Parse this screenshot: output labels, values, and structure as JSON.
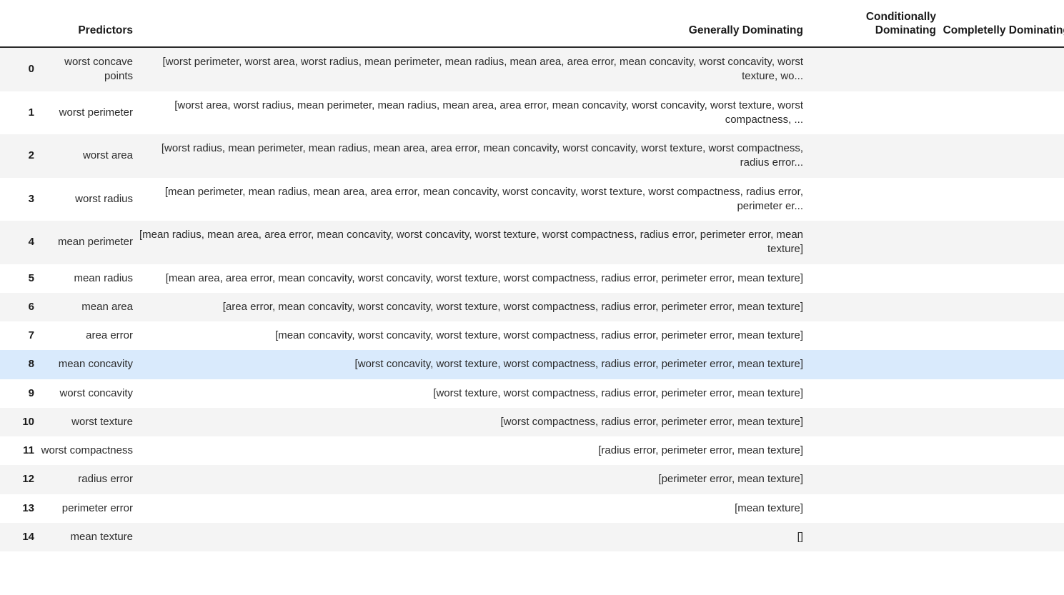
{
  "table": {
    "headers": {
      "index": "",
      "predictors": "Predictors",
      "generally_dominating": "Generally Dominating",
      "conditionally_dominating": "Conditionally Dominating",
      "completelly_dominating": "Completelly Dominating"
    },
    "highlighted_row_index": 8,
    "highlight_color": "#d9eafc",
    "stripe_color": "#f4f4f4",
    "rows": [
      {
        "index": "0",
        "predictor": "worst concave points",
        "generally_dominating": "[worst perimeter, worst area, worst radius, mean perimeter, mean radius, mean area, area error, mean concavity, worst concavity, worst texture, wo...",
        "conditionally_dominating": "",
        "completelly_dominating": ""
      },
      {
        "index": "1",
        "predictor": "worst perimeter",
        "generally_dominating": "[worst area, worst radius, mean perimeter, mean radius, mean area, area error, mean concavity, worst concavity, worst texture, worst compactness, ...",
        "conditionally_dominating": "",
        "completelly_dominating": ""
      },
      {
        "index": "2",
        "predictor": "worst area",
        "generally_dominating": "[worst radius, mean perimeter, mean radius, mean area, area error, mean concavity, worst concavity, worst texture, worst compactness, radius error...",
        "conditionally_dominating": "",
        "completelly_dominating": ""
      },
      {
        "index": "3",
        "predictor": "worst radius",
        "generally_dominating": "[mean perimeter, mean radius, mean area, area error, mean concavity, worst concavity, worst texture, worst compactness, radius error, perimeter er...",
        "conditionally_dominating": "",
        "completelly_dominating": ""
      },
      {
        "index": "4",
        "predictor": "mean perimeter",
        "generally_dominating": "[mean radius, mean area, area error, mean concavity, worst concavity, worst texture, worst compactness, radius error, perimeter error, mean texture]",
        "conditionally_dominating": "",
        "completelly_dominating": ""
      },
      {
        "index": "5",
        "predictor": "mean radius",
        "generally_dominating": "[mean area, area error, mean concavity, worst concavity, worst texture, worst compactness, radius error, perimeter error, mean texture]",
        "conditionally_dominating": "",
        "completelly_dominating": ""
      },
      {
        "index": "6",
        "predictor": "mean area",
        "generally_dominating": "[area error, mean concavity, worst concavity, worst texture, worst compactness, radius error, perimeter error, mean texture]",
        "conditionally_dominating": "",
        "completelly_dominating": ""
      },
      {
        "index": "7",
        "predictor": "area error",
        "generally_dominating": "[mean concavity, worst concavity, worst texture, worst compactness, radius error, perimeter error, mean texture]",
        "conditionally_dominating": "",
        "completelly_dominating": ""
      },
      {
        "index": "8",
        "predictor": "mean concavity",
        "generally_dominating": "[worst concavity, worst texture, worst compactness, radius error, perimeter error, mean texture]",
        "conditionally_dominating": "",
        "completelly_dominating": ""
      },
      {
        "index": "9",
        "predictor": "worst concavity",
        "generally_dominating": "[worst texture, worst compactness, radius error, perimeter error, mean texture]",
        "conditionally_dominating": "",
        "completelly_dominating": ""
      },
      {
        "index": "10",
        "predictor": "worst texture",
        "generally_dominating": "[worst compactness, radius error, perimeter error, mean texture]",
        "conditionally_dominating": "",
        "completelly_dominating": ""
      },
      {
        "index": "11",
        "predictor": "worst compactness",
        "generally_dominating": "[radius error, perimeter error, mean texture]",
        "conditionally_dominating": "",
        "completelly_dominating": ""
      },
      {
        "index": "12",
        "predictor": "radius error",
        "generally_dominating": "[perimeter error, mean texture]",
        "conditionally_dominating": "",
        "completelly_dominating": ""
      },
      {
        "index": "13",
        "predictor": "perimeter error",
        "generally_dominating": "[mean texture]",
        "conditionally_dominating": "",
        "completelly_dominating": ""
      },
      {
        "index": "14",
        "predictor": "mean texture",
        "generally_dominating": "[]",
        "conditionally_dominating": "",
        "completelly_dominating": ""
      }
    ]
  }
}
